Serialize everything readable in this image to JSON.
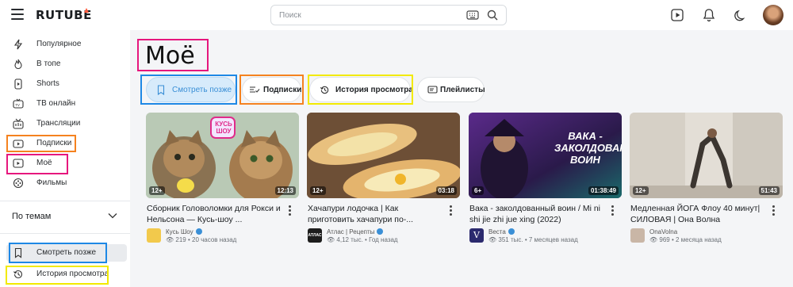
{
  "header": {
    "logo": "RUTUBE",
    "search_placeholder": "Поиск"
  },
  "sidebar": {
    "items": [
      {
        "label": "Популярное",
        "icon": "lightning-icon"
      },
      {
        "label": "В топе",
        "icon": "flame-icon"
      },
      {
        "label": "Shorts",
        "icon": "shorts-icon"
      },
      {
        "label": "ТВ онлайн",
        "icon": "tv-icon"
      },
      {
        "label": "Трансляции",
        "icon": "broadcast-icon"
      },
      {
        "label": "Подписки",
        "icon": "subscriptions-icon"
      },
      {
        "label": "Моё",
        "icon": "profile-icon"
      },
      {
        "label": "Фильмы",
        "icon": "film-icon"
      }
    ],
    "themes_label": "По темам",
    "bottom_items": [
      {
        "label": "Смотреть позже",
        "icon": "bookmark-icon"
      },
      {
        "label": "История просмотра",
        "icon": "history-icon"
      }
    ]
  },
  "main": {
    "title": "Моё",
    "tabs": [
      {
        "label": "Смотреть позже",
        "icon": "bookmark-icon",
        "active": true
      },
      {
        "label": "Подписки",
        "icon": "subscriptions-list-icon",
        "active": false
      },
      {
        "label": "История просмотра",
        "icon": "history-icon",
        "active": false
      },
      {
        "label": "Плейлисты",
        "icon": "playlist-icon",
        "active": false
      }
    ],
    "videos": [
      {
        "title": "Сборник Головоломки для Рокси и Нельсона — Кусь-шоу ...",
        "channel": "Кусь Шоу",
        "verified": true,
        "views": "219",
        "age": "20 часов назад",
        "age_rating": "12+",
        "duration": "12:13"
      },
      {
        "title": "Хачапури лодочка | Как приготовить хачапури по-...",
        "channel": "Атлас | Рецепты",
        "verified": true,
        "views": "4,12 тыс.",
        "age": "Год назад",
        "age_rating": "12+",
        "duration": "03:18"
      },
      {
        "title": "Вака - заколдованный воин / Mi ni shi jie zhi jue xing (2022)",
        "channel": "Веста",
        "verified": true,
        "views": "351 тыс.",
        "age": "7 месяцев назад",
        "age_rating": "6+",
        "duration": "01:38:49"
      },
      {
        "title": "Медленная ЙОГА Флоу 40 минут| СИЛОВАЯ | Она Волна",
        "channel": "OnaVolna",
        "verified": false,
        "views": "969",
        "age": "2 месяца назад",
        "age_rating": "12+",
        "duration": "51:43"
      }
    ],
    "thumb_texts": {
      "kus_logo": "КУСЬ ШОУ",
      "vaka_title": "ВАКА - ЗАКОЛДОВАННЫЙ ВОИН",
      "atlas_logo": "АТЛАС",
      "vesta_logo": "V"
    }
  },
  "colors": {
    "accent": "#3a8fd6",
    "annot_pink": "#e6177d",
    "annot_orange": "#f5821f",
    "annot_blue": "#1e88e5",
    "annot_yellow": "#f2ea00"
  }
}
